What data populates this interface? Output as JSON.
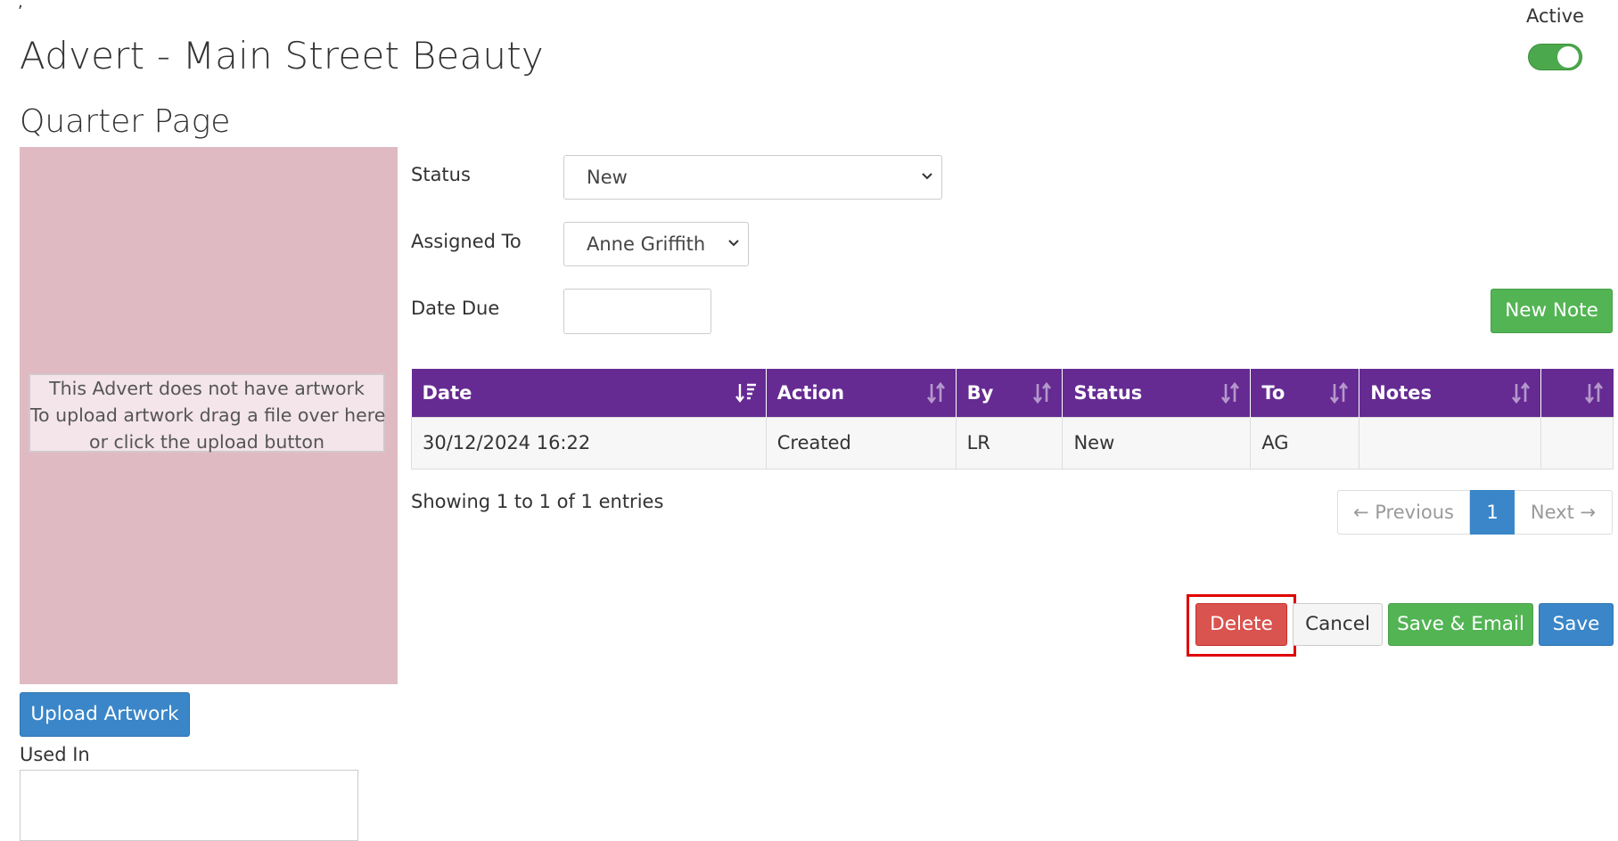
{
  "header": {
    "stray_mark": ",",
    "title": "Advert - Main Street Beauty",
    "subtitle": "Quarter Page",
    "active_label": "Active",
    "active_on": true
  },
  "artwork": {
    "line1": "This Advert does not have artwork",
    "line2": "To upload artwork drag a file over here",
    "line3": "or click the upload button",
    "upload_label": "Upload Artwork",
    "used_in_label": "Used In"
  },
  "form": {
    "status_label": "Status",
    "status_value": "New",
    "assigned_label": "Assigned To",
    "assigned_value": "Anne Griffith",
    "date_due_label": "Date Due",
    "date_due_value": ""
  },
  "new_note_label": "New Note",
  "table": {
    "columns": [
      "Date",
      "Action",
      "By",
      "Status",
      "To",
      "Notes",
      ""
    ],
    "rows": [
      [
        "30/12/2024 16:22",
        "Created",
        "LR",
        "New",
        "AG",
        "",
        ""
      ]
    ]
  },
  "pagination": {
    "info": "Showing 1 to 1 of 1 entries",
    "previous": "← Previous",
    "current": "1",
    "next": "Next →"
  },
  "actions": {
    "delete": "Delete",
    "cancel": "Cancel",
    "save_email": "Save & Email",
    "save": "Save"
  },
  "colors": {
    "header_purple": "#652b92",
    "primary_blue": "#3a86c8",
    "success_green": "#53b454",
    "danger_red": "#d9534f",
    "artwork_bg": "#dfbac3",
    "highlight_red": "#e00000"
  },
  "icons": {
    "chevron": "chevron-down-icon",
    "sort": "sort-icon",
    "sort_active": "sort-desc-icon"
  }
}
